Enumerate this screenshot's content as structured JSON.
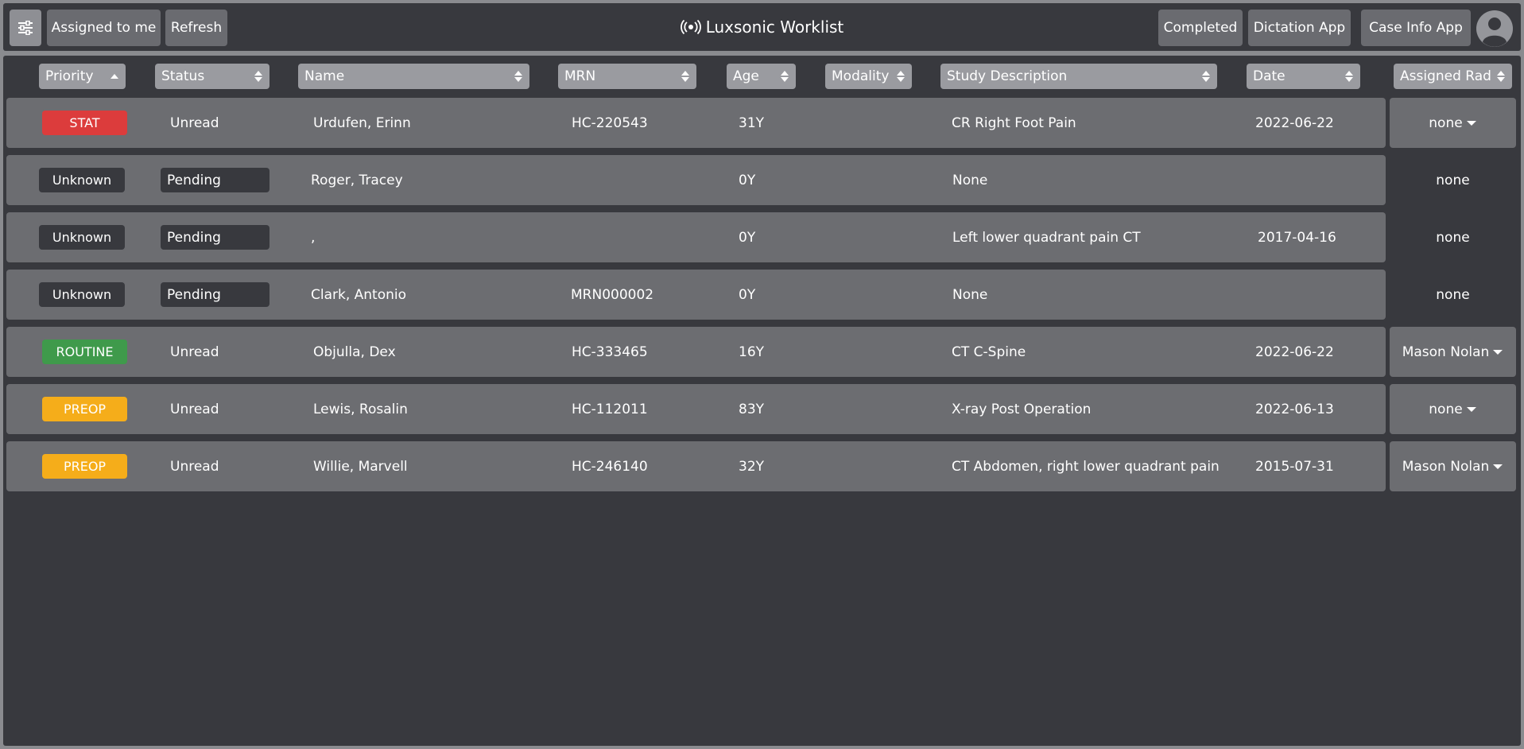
{
  "header": {
    "title": "Luxsonic Worklist",
    "buttons": {
      "assigned": "Assigned to me",
      "refresh": "Refresh",
      "completed": "Completed",
      "dictation": "Dictation App",
      "case_info": "Case Info App"
    }
  },
  "columns": {
    "priority": "Priority",
    "status": "Status",
    "name": "Name",
    "mrn": "MRN",
    "age": "Age",
    "modality": "Modality",
    "study_description": "Study Description",
    "date": "Date",
    "assigned_rad": "Assigned Rad"
  },
  "sort": {
    "column": "Priority",
    "direction": "ascending"
  },
  "colors": {
    "stat": "#dc3c3c",
    "routine": "#3f9a4b",
    "preop": "#f5ad1a",
    "unknown": "#38393e",
    "row_bg": "#6c6d71",
    "panel_bg": "#38393e"
  },
  "rows": [
    {
      "priority": "STAT",
      "priority_kind": "stat",
      "status": "Unread",
      "status_kind": "unread",
      "name": "Urdufen, Erinn",
      "mrn": "HC-220543",
      "age": "31Y",
      "modality": "",
      "study": "CR Right Foot Pain",
      "date": "2022-06-22",
      "rad": "none",
      "rad_dropdown": true
    },
    {
      "priority": "Unknown",
      "priority_kind": "unknown",
      "status": "Pending",
      "status_kind": "pending",
      "name": "Roger, Tracey",
      "mrn": "",
      "age": "0Y",
      "modality": "",
      "study": "None",
      "date": "",
      "rad": "none",
      "rad_dropdown": false
    },
    {
      "priority": "Unknown",
      "priority_kind": "unknown",
      "status": "Pending",
      "status_kind": "pending",
      "name": ",",
      "mrn": "",
      "age": "0Y",
      "modality": "",
      "study": "Left lower quadrant pain CT",
      "date": "2017-04-16",
      "rad": "none",
      "rad_dropdown": false
    },
    {
      "priority": "Unknown",
      "priority_kind": "unknown",
      "status": "Pending",
      "status_kind": "pending",
      "name": "Clark, Antonio",
      "mrn": "MRN000002",
      "age": "0Y",
      "modality": "",
      "study": "None",
      "date": "",
      "rad": "none",
      "rad_dropdown": false
    },
    {
      "priority": "ROUTINE",
      "priority_kind": "routine",
      "status": "Unread",
      "status_kind": "unread",
      "name": "Objulla, Dex",
      "mrn": "HC-333465",
      "age": "16Y",
      "modality": "",
      "study": "CT C-Spine",
      "date": "2022-06-22",
      "rad": "Mason Nolan",
      "rad_dropdown": true
    },
    {
      "priority": "PREOP",
      "priority_kind": "preop",
      "status": "Unread",
      "status_kind": "unread",
      "name": "Lewis, Rosalin",
      "mrn": "HC-112011",
      "age": "83Y",
      "modality": "",
      "study": "X-ray Post Operation",
      "date": "2022-06-13",
      "rad": "none",
      "rad_dropdown": true
    },
    {
      "priority": "PREOP",
      "priority_kind": "preop",
      "status": "Unread",
      "status_kind": "unread",
      "name": "Willie, Marvell",
      "mrn": "HC-246140",
      "age": "32Y",
      "modality": "",
      "study": "CT Abdomen, right lower quadrant pain",
      "date": "2015-07-31",
      "rad": "Mason Nolan",
      "rad_dropdown": true
    }
  ]
}
